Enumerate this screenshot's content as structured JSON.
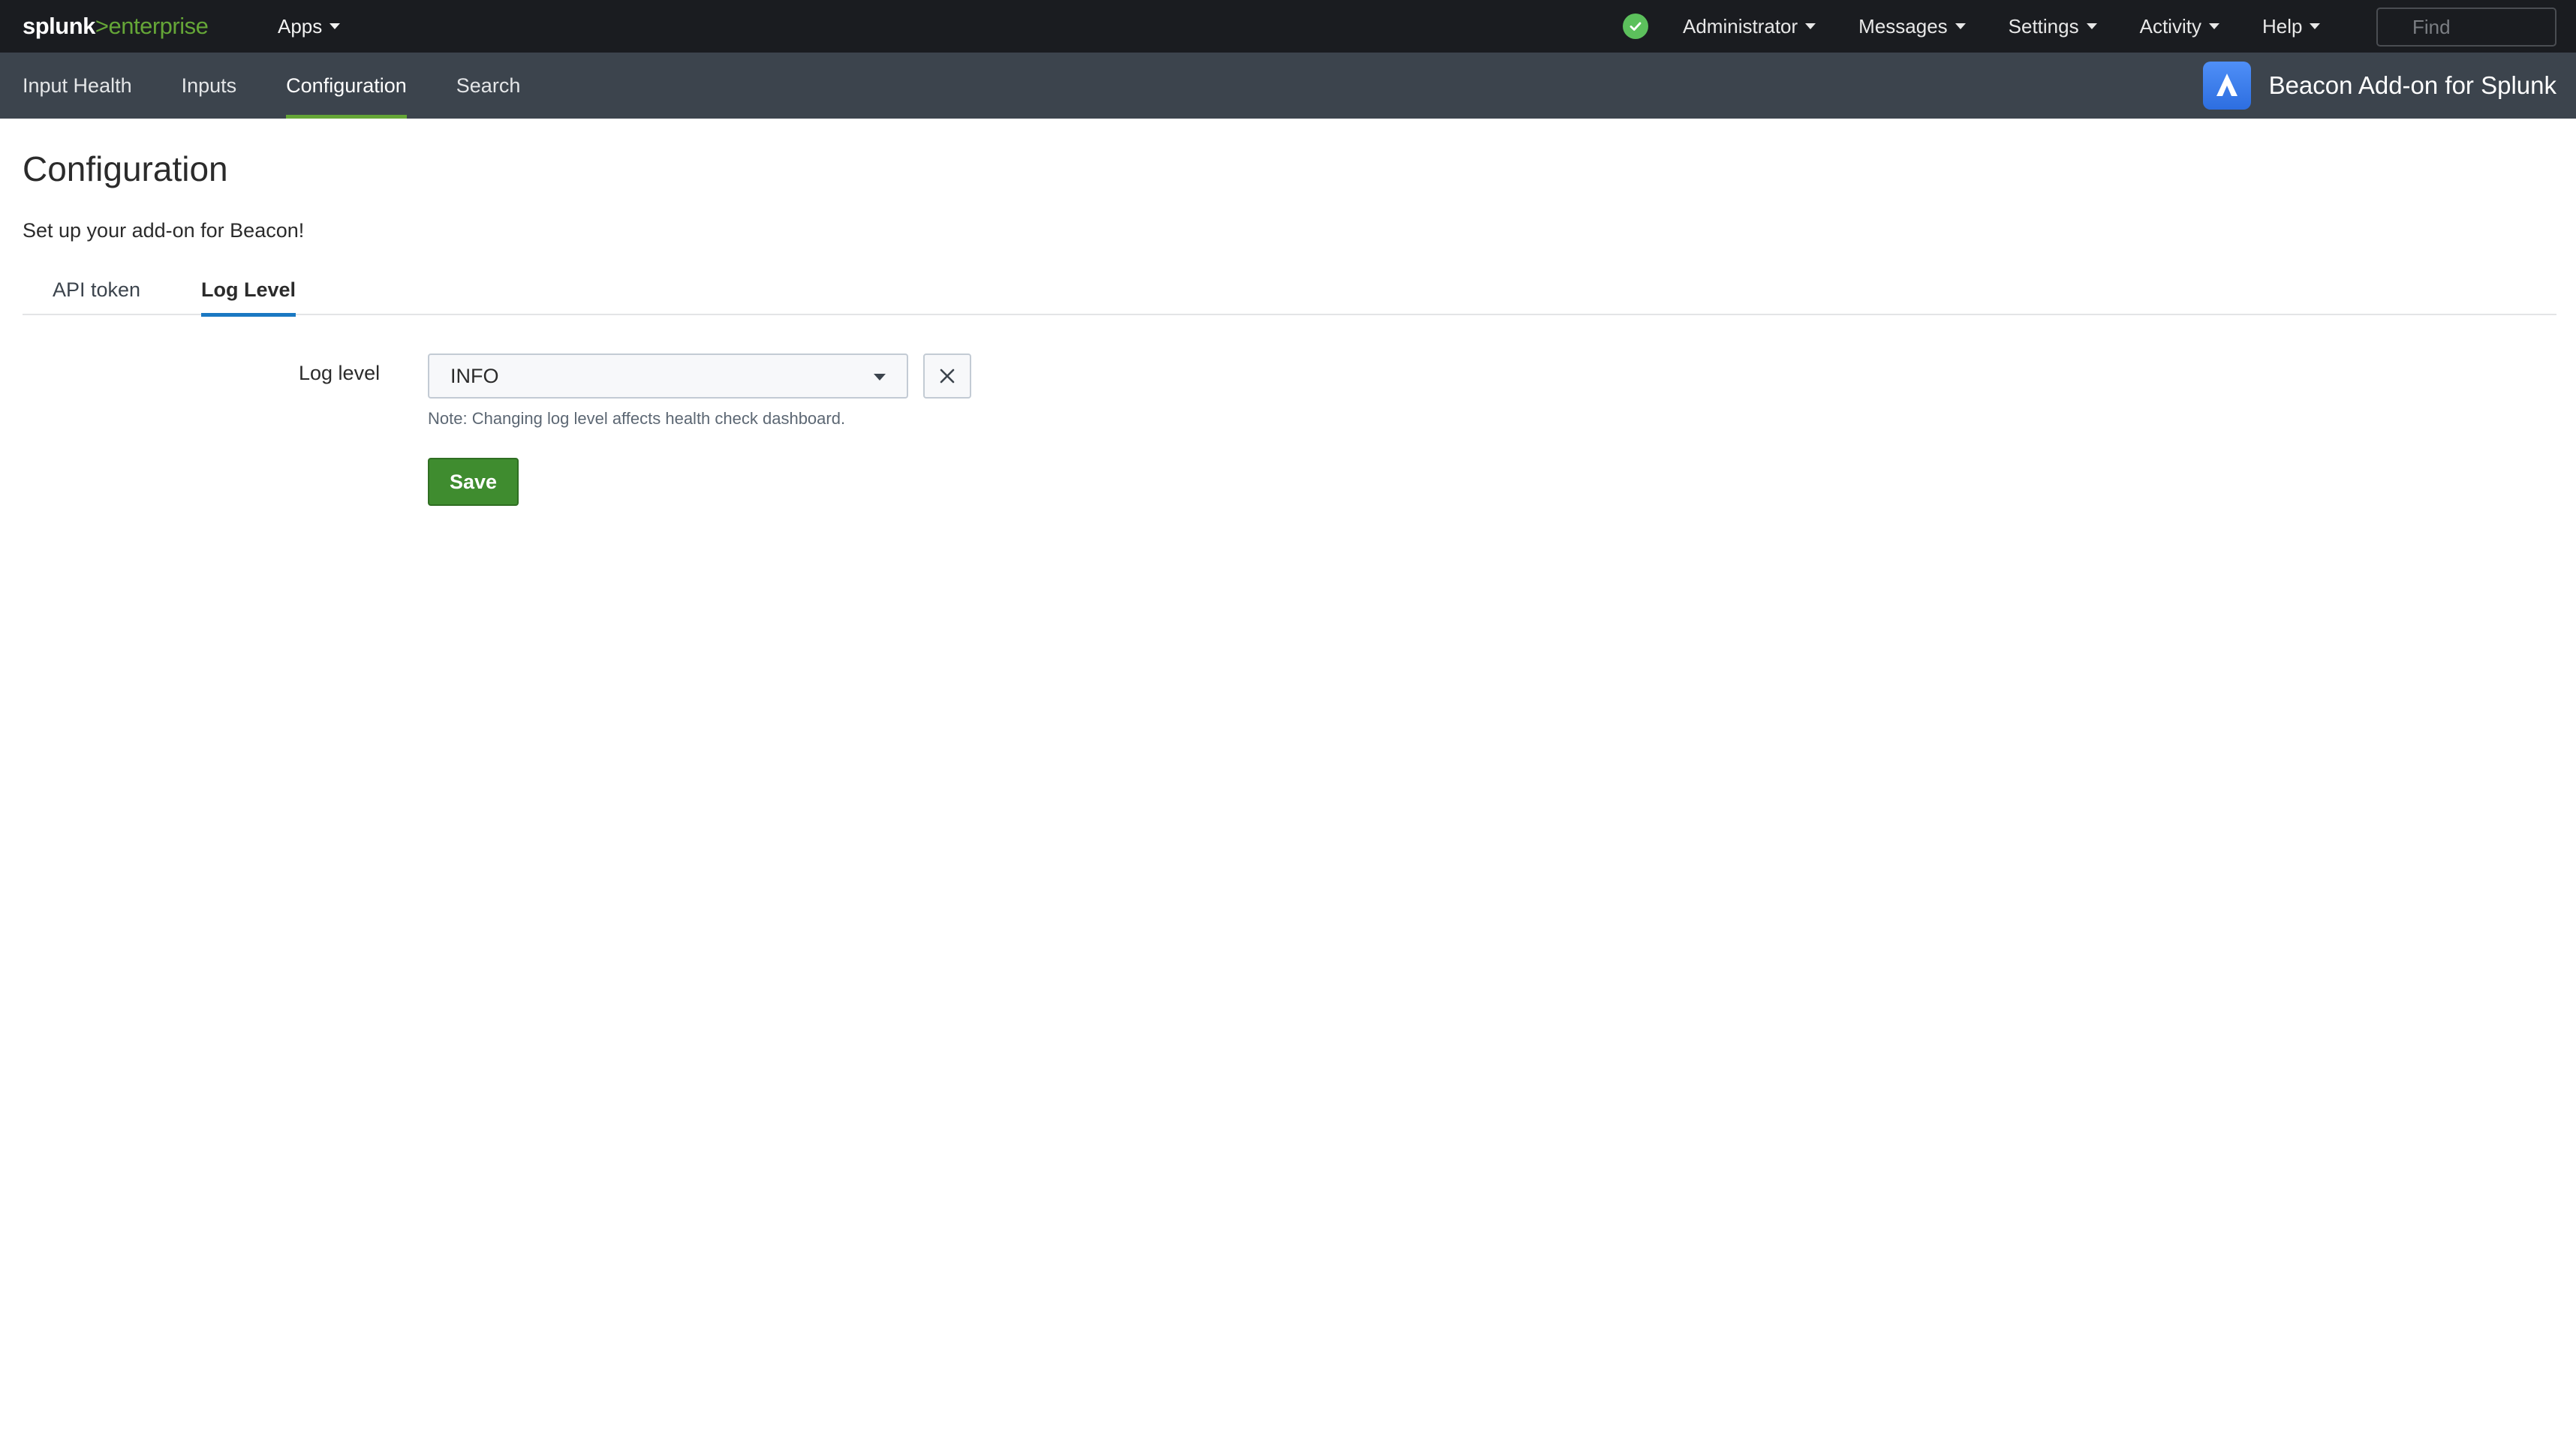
{
  "topbar": {
    "logo_prefix": "splunk",
    "logo_suffix": ">enterprise",
    "apps_label": "Apps",
    "status_icon": "check-circle-icon",
    "status_color": "#5cc05c",
    "menus": [
      "Administrator",
      "Messages",
      "Settings",
      "Activity",
      "Help"
    ],
    "find_placeholder": "Find"
  },
  "appbar": {
    "nav_items": [
      "Input Health",
      "Inputs",
      "Configuration",
      "Search"
    ],
    "active_nav": "Configuration",
    "app_name": "Beacon Add-on for Splunk",
    "app_icon": "beacon-logo-icon",
    "active_color": "#65a637"
  },
  "main": {
    "title": "Configuration",
    "subtitle": "Set up your add-on for Beacon!",
    "tabs": [
      "API token",
      "Log Level"
    ],
    "active_tab": "Log Level",
    "form": {
      "log_level_label": "Log level",
      "log_level_value": "INFO",
      "clear_icon": "close-icon",
      "note": "Note: Changing log level affects health check dashboard.",
      "save_label": "Save"
    }
  },
  "colors": {
    "topbar_bg": "#1a1c20",
    "appbar_bg": "#3c444d",
    "save_button": "#3f8c2f",
    "active_tab_underline": "#1a78c2"
  }
}
